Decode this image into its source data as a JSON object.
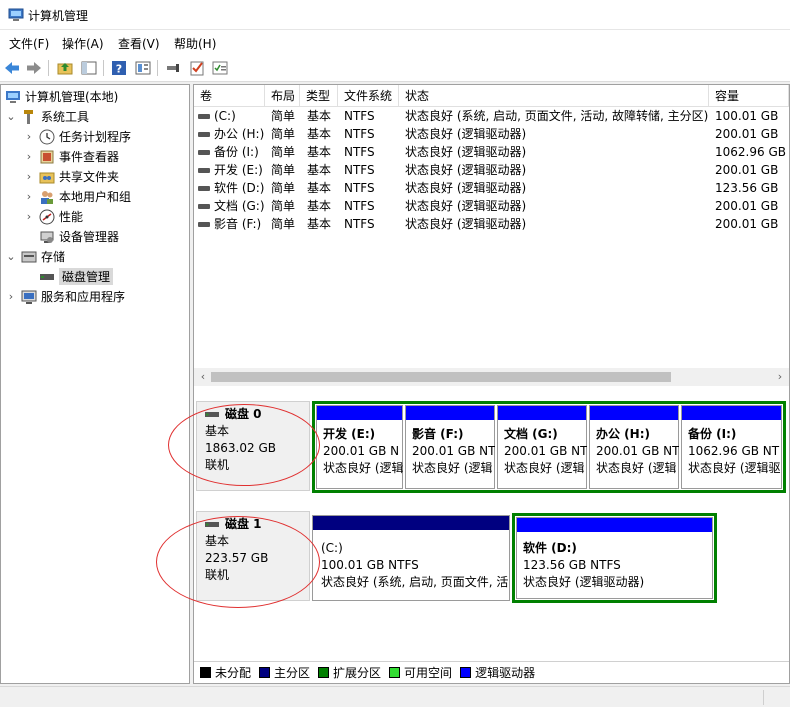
{
  "window": {
    "title": "计算机管理"
  },
  "menu": [
    "文件(F)",
    "操作(A)",
    "查看(V)",
    "帮助(H)"
  ],
  "toolbar": {
    "buttons": [
      "back-icon",
      "forward-icon",
      "up-folder-icon",
      "show-hide-tree-icon",
      "help-icon",
      "properties-icon",
      "connect-icon",
      "check-icon",
      "checklist-icon"
    ]
  },
  "tree": {
    "root": "计算机管理(本地)",
    "system_tools": "系统工具",
    "task_scheduler": "任务计划程序",
    "event_viewer": "事件查看器",
    "shared_folders": "共享文件夹",
    "local_users": "本地用户和组",
    "performance": "性能",
    "device_manager": "设备管理器",
    "storage": "存储",
    "disk_management": "磁盘管理",
    "services_apps": "服务和应用程序"
  },
  "volumes": {
    "headers": [
      "卷",
      "布局",
      "类型",
      "文件系统",
      "状态",
      "容量"
    ],
    "rows": [
      {
        "vol": "(C:)",
        "layout": "简单",
        "type": "基本",
        "fs": "NTFS",
        "status": "状态良好 (系统, 启动, 页面文件, 活动, 故障转储, 主分区)",
        "cap": "100.01 GB"
      },
      {
        "vol": "办公 (H:)",
        "layout": "简单",
        "type": "基本",
        "fs": "NTFS",
        "status": "状态良好 (逻辑驱动器)",
        "cap": "200.01 GB"
      },
      {
        "vol": "备份 (I:)",
        "layout": "简单",
        "type": "基本",
        "fs": "NTFS",
        "status": "状态良好 (逻辑驱动器)",
        "cap": "1062.96 GB"
      },
      {
        "vol": "开发 (E:)",
        "layout": "简单",
        "type": "基本",
        "fs": "NTFS",
        "status": "状态良好 (逻辑驱动器)",
        "cap": "200.01 GB"
      },
      {
        "vol": "软件 (D:)",
        "layout": "简单",
        "type": "基本",
        "fs": "NTFS",
        "status": "状态良好 (逻辑驱动器)",
        "cap": "123.56 GB"
      },
      {
        "vol": "文档 (G:)",
        "layout": "简单",
        "type": "基本",
        "fs": "NTFS",
        "status": "状态良好 (逻辑驱动器)",
        "cap": "200.01 GB"
      },
      {
        "vol": "影音 (F:)",
        "layout": "简单",
        "type": "基本",
        "fs": "NTFS",
        "status": "状态良好 (逻辑驱动器)",
        "cap": "200.01 GB"
      }
    ]
  },
  "disk0": {
    "name": "磁盘 0",
    "type": "基本",
    "size": "1863.02 GB",
    "status": "联机",
    "partitions": [
      {
        "name": "开发  (E:)",
        "size": "200.01 GB N",
        "status": "状态良好 (逻辑"
      },
      {
        "name": "影音  (F:)",
        "size": "200.01 GB NT",
        "status": "状态良好 (逻辑"
      },
      {
        "name": "文档  (G:)",
        "size": "200.01 GB NT",
        "status": "状态良好 (逻辑"
      },
      {
        "name": "办公  (H:)",
        "size": "200.01 GB NT",
        "status": "状态良好 (逻辑"
      },
      {
        "name": "备份  (I:)",
        "size": "1062.96 GB NT",
        "status": "状态良好 (逻辑驱"
      }
    ]
  },
  "disk1": {
    "name": "磁盘 1",
    "type": "基本",
    "size": "223.57 GB",
    "status": "联机",
    "partitions": [
      {
        "name": "(C:)",
        "size": "100.01 GB NTFS",
        "status": "状态良好 (系统, 启动, 页面文件, 活"
      },
      {
        "name": "软件  (D:)",
        "size": "123.56 GB NTFS",
        "status": "状态良好 (逻辑驱动器)"
      }
    ]
  },
  "legend": [
    "未分配",
    "主分区",
    "扩展分区",
    "可用空间",
    "逻辑驱动器"
  ],
  "colors": {
    "unallocated": "#000000",
    "primary": "#000080",
    "extended": "#008000",
    "free": "#32dc32",
    "logical": "#0000ff",
    "annotation": "#e03030"
  }
}
